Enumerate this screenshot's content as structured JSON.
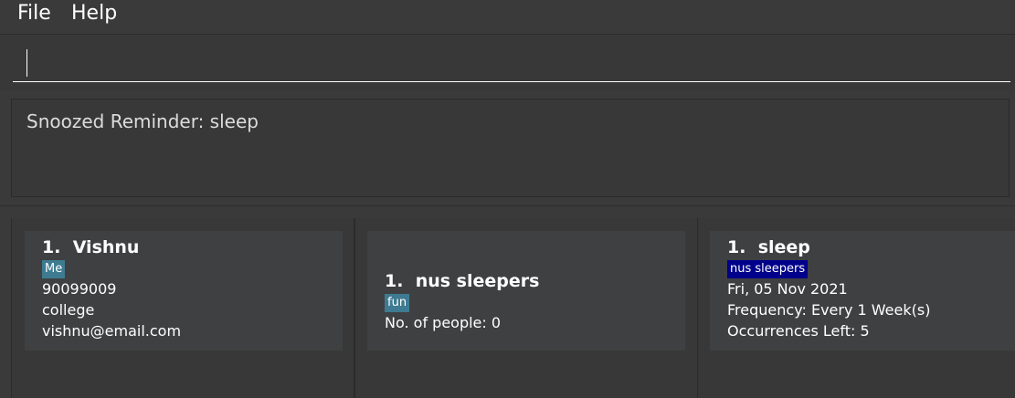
{
  "menu": {
    "file_label": "File",
    "help_label": "Help"
  },
  "command_box": {
    "value": ""
  },
  "result_display": {
    "text": "Snoozed Reminder: sleep"
  },
  "persons": [
    {
      "index": "1.",
      "name": "Vishnu",
      "tags": [
        "Me"
      ],
      "phone": "90099009",
      "address": "college",
      "email": "vishnu@email.com"
    }
  ],
  "groups": [
    {
      "index": "1.",
      "name": "nus sleepers",
      "tags": [
        "fun"
      ],
      "people_count_text": "No. of people: 0"
    }
  ],
  "reminders": [
    {
      "index": "1.",
      "name": "sleep",
      "group_tag": "nus sleepers",
      "date": "Fri, 05 Nov 2021",
      "frequency": "Frequency: Every 1 Week(s)",
      "occurrences": "Occurrences Left: 5"
    }
  ],
  "colors": {
    "background": "#3a3a3a",
    "card": "#3f4042",
    "tag": "#3e7b91",
    "group_tag": "#00008b"
  }
}
